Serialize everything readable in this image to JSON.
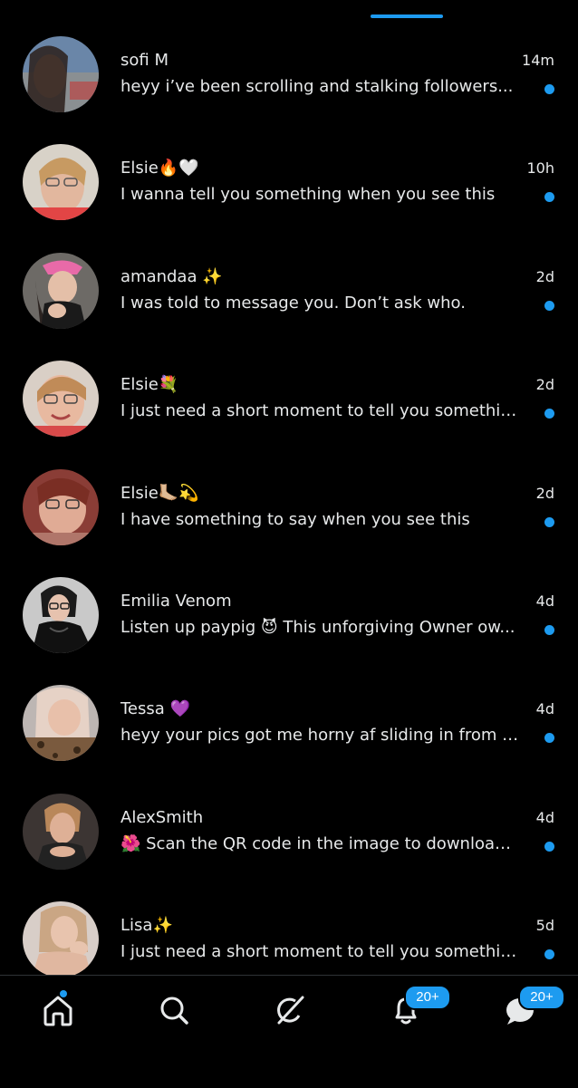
{
  "colors": {
    "accent": "#1d9bf0",
    "background": "#000000",
    "text": "#e7e9ea"
  },
  "messages": [
    {
      "name": "sofi M",
      "preview": "heyy i’ve been scrolling and stalking followers...",
      "time": "14m",
      "unread": true
    },
    {
      "name": "Elsie🔥🤍",
      "preview": "I wanna tell you something when you see this",
      "time": "10h",
      "unread": true
    },
    {
      "name": "amandaa ✨",
      "preview": "I was told to message you. Don’t ask who.",
      "time": "2d",
      "unread": true
    },
    {
      "name": "Elsie💐",
      "preview": "I just need a short moment to tell you something",
      "time": "2d",
      "unread": true
    },
    {
      "name": "Elsie🦶🏼💫",
      "preview": "I have something to say when you see this",
      "time": "2d",
      "unread": true
    },
    {
      "name": "Emilia Venom",
      "preview": "Listen up paypig 😈 This unforgiving Owner ow...",
      "time": "4d",
      "unread": true
    },
    {
      "name": "Tessa 💜",
      "preview": "heyy your pics got me horny af sliding in from a...",
      "time": "4d",
      "unread": true
    },
    {
      "name": "AlexSmith",
      "preview": "🌺 Scan the QR code in the image to download...",
      "time": "4d",
      "unread": true
    },
    {
      "name": "Lisa✨",
      "preview": "I just need a short moment to tell you something",
      "time": "5d",
      "unread": true
    }
  ],
  "nav": {
    "home_icon": "home-icon",
    "search_icon": "search-icon",
    "grok_icon": "grok-icon",
    "notifications_icon": "bell-icon",
    "notifications_badge": "20+",
    "messages_icon": "messages-icon",
    "messages_badge": "20+"
  }
}
